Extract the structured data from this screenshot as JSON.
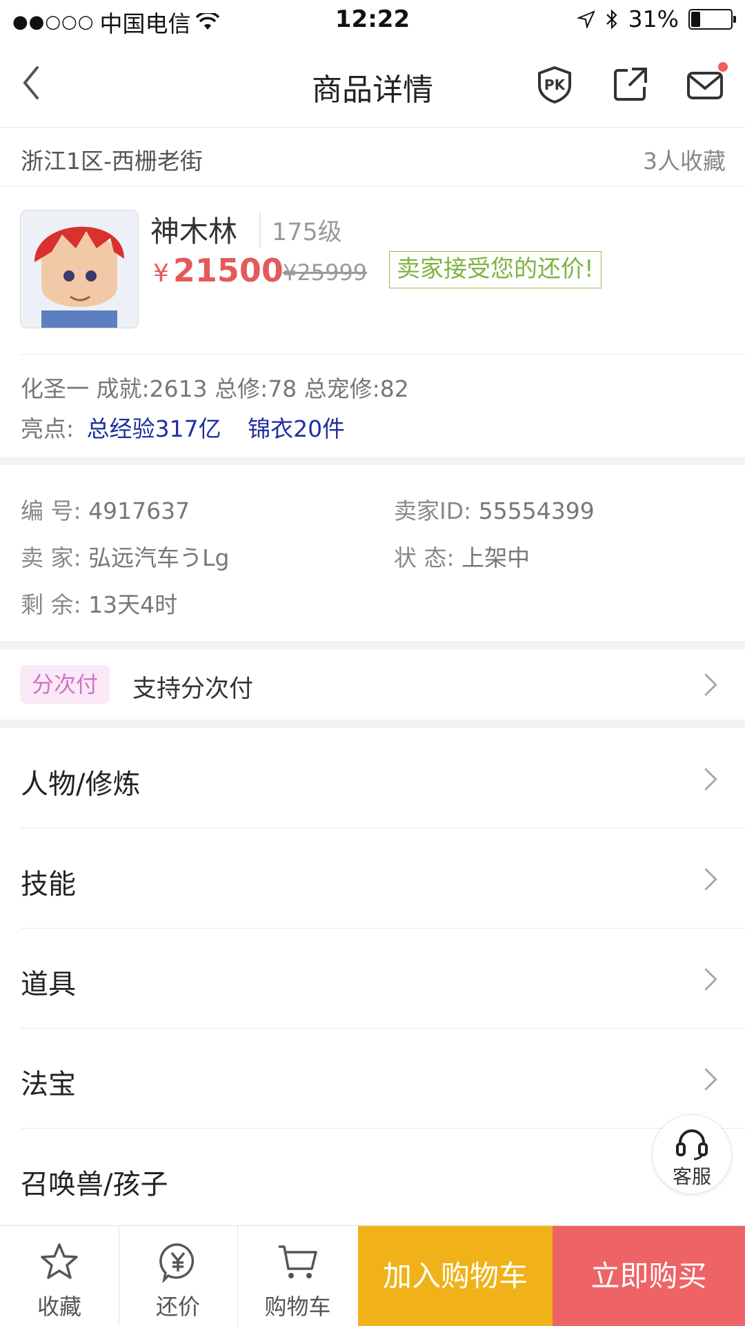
{
  "status_bar": {
    "signal_dots": "●●○○○",
    "carrier": "中国电信",
    "time": "12:22",
    "battery": "31%"
  },
  "nav": {
    "title": "商品详情",
    "pk_label": "PK"
  },
  "server": {
    "name": "浙江1区-西栅老街",
    "favorites": "3人收藏"
  },
  "product": {
    "name": "神木林",
    "level": "175级",
    "currency": "¥",
    "price": "21500",
    "old_price": "¥25999",
    "accept_tag": "卖家接受您的还价!",
    "attrs": "化圣一  成就:2613  总修:78  总宠修:82",
    "highlights_label": "亮点:",
    "highlights": [
      "总经验317亿",
      "锦衣20件"
    ]
  },
  "info": {
    "number_key": "编 号:",
    "number_val": "4917637",
    "seller_id_key": "卖家ID:",
    "seller_id_val": "55554399",
    "seller_key": "卖 家:",
    "seller_val": "弘远汽车うLg",
    "status_key": "状 态:",
    "status_val": "上架中",
    "remain_key": "剩 余:",
    "remain_val": "13天4时"
  },
  "installment": {
    "tag": "分次付",
    "text": "支持分次付"
  },
  "menu": [
    {
      "label": "人物/修炼"
    },
    {
      "label": "技能"
    },
    {
      "label": "道具"
    },
    {
      "label": "法宝"
    },
    {
      "label": "召唤兽/孩子"
    }
  ],
  "service": {
    "label": "客服"
  },
  "bottom_bar": {
    "favorite_label": "收藏",
    "bargain_label": "还价",
    "cart_label": "购物车",
    "add_cart_label": "加入购物车",
    "buy_now_label": "立即购买"
  },
  "colors": {
    "price_red": "#e5595b",
    "accept_green": "#7cb342",
    "highlight_blue": "#1f2f9e",
    "add_cart_yellow": "#f0b218",
    "buy_red": "#ee6366",
    "installment_pink": "#d173c7"
  },
  "icons": [
    "back-chevron-icon",
    "pk-shield-icon",
    "share-icon",
    "mail-icon",
    "star-icon",
    "yuan-bubble-icon",
    "cart-icon",
    "headset-icon",
    "chevron-right-icon"
  ]
}
